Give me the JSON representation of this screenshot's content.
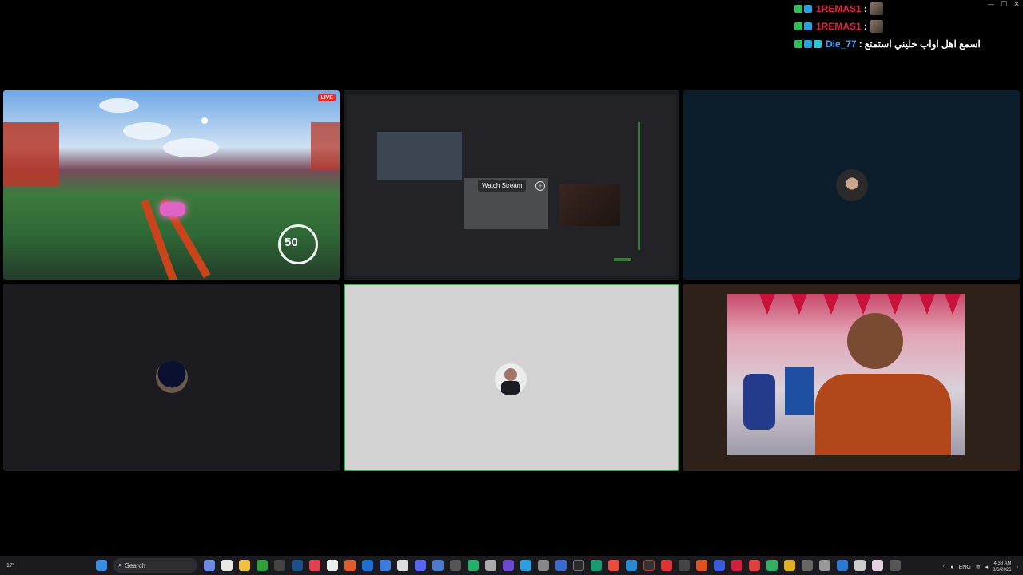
{
  "window_controls": {
    "minimize": "—",
    "maximize": "☐",
    "close": "✕"
  },
  "chat": {
    "messages": [
      {
        "user": "1REMAS1",
        "separator": ":",
        "text": "",
        "user_color": "#e0223a"
      },
      {
        "user": "1REMAS1",
        "separator": ":",
        "text": "",
        "user_color": "#e0223a"
      },
      {
        "user": "Die_77",
        "separator": ":",
        "text": "اسمع اهل اواب خليني استمتع",
        "user_color": "#3aa0ff"
      }
    ]
  },
  "tiles": {
    "stream_game": {
      "live_badge": "LIVE",
      "boost": "50"
    },
    "screen_share": {
      "watch_label": "Watch Stream"
    }
  },
  "taskbar": {
    "search_placeholder": "Search",
    "weather": "17°",
    "language": "ENG",
    "time": "4:38 AM",
    "date": "3/6/2026"
  }
}
